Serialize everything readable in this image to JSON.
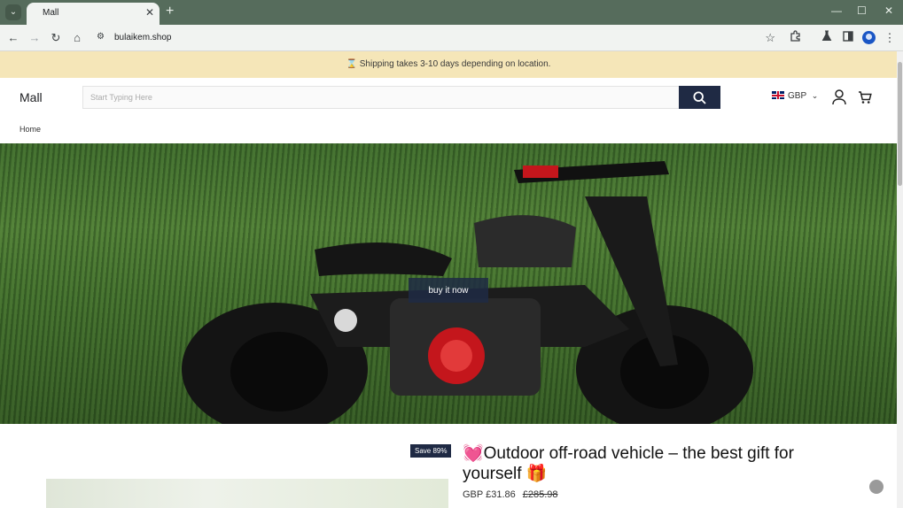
{
  "browser": {
    "tab_title": "Mall",
    "url": "bulaikem.shop",
    "icons": [
      "tab-search-icon",
      "close-icon",
      "plus-icon",
      "minimize-icon",
      "maximize-icon",
      "close-window-icon",
      "back-icon",
      "forward-icon",
      "reload-icon",
      "home-icon",
      "site-info-icon",
      "star-icon",
      "extensions-icon",
      "labs-icon",
      "sidepanel-icon",
      "profile-icon",
      "menu-icon"
    ]
  },
  "announcement": {
    "icon": "hourglass-icon",
    "text": "⌛ Shipping takes 3-10 days depending on location."
  },
  "header": {
    "logo": "Mall",
    "search": {
      "placeholder": "Start Typing Here"
    },
    "currency": "GBP"
  },
  "breadcrumb": "Home",
  "hero": {
    "button_label": "buy it now"
  },
  "product": {
    "badge": "Save 89%",
    "title": "💓Outdoor off-road vehicle – the best gift for yourself 🎁",
    "price": "GBP £31.86",
    "compare_price": "£285.98"
  },
  "colors": {
    "announcement_bg": "#f5e6b8",
    "accent_dark": "#1f2a44",
    "chrome_tabbar": "#566c5c"
  }
}
